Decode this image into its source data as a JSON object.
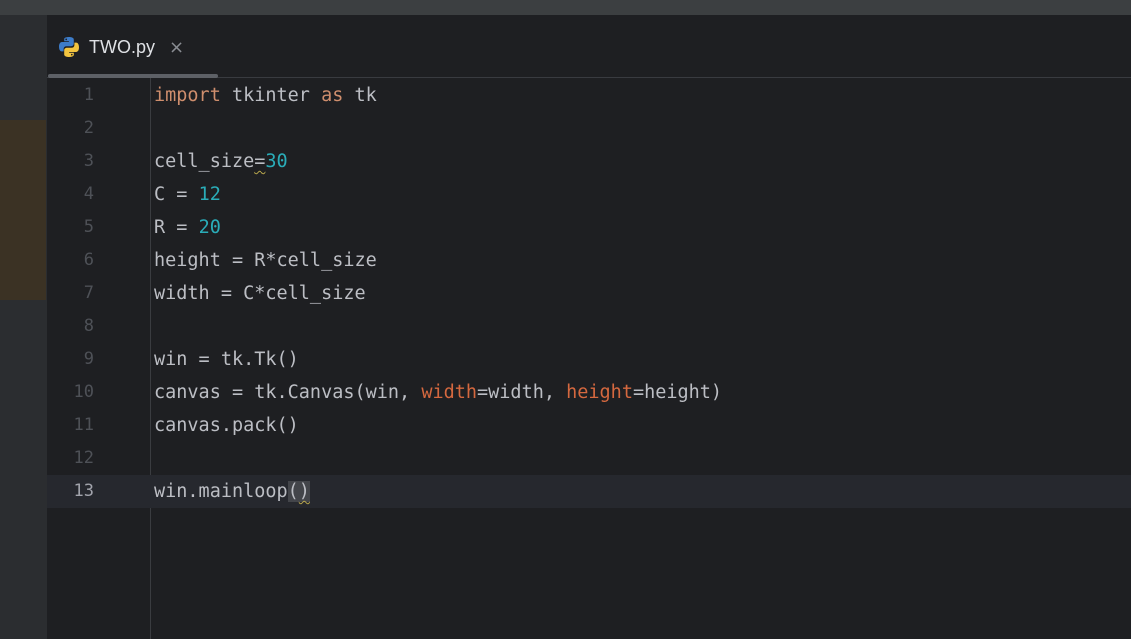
{
  "tab": {
    "filename": "TWO.py",
    "close_glyph": "×",
    "icon": "python-icon"
  },
  "colors": {
    "keyword": "#cf8e6d",
    "number": "#2aacb8",
    "parameter": "#d5683f",
    "text": "#bcbec4",
    "background": "#1e1f22"
  },
  "editor": {
    "current_line": 13,
    "lines": [
      {
        "n": "1",
        "tokens": [
          {
            "t": "import",
            "c": "kw"
          },
          {
            "t": " tkinter ",
            "c": ""
          },
          {
            "t": "as",
            "c": "kw"
          },
          {
            "t": " tk",
            "c": ""
          }
        ]
      },
      {
        "n": "2",
        "tokens": []
      },
      {
        "n": "3",
        "tokens": [
          {
            "t": "cell_size",
            "c": ""
          },
          {
            "t": "=",
            "c": "squig"
          },
          {
            "t": "30",
            "c": "num"
          }
        ]
      },
      {
        "n": "4",
        "tokens": [
          {
            "t": "C = ",
            "c": ""
          },
          {
            "t": "12",
            "c": "num"
          }
        ]
      },
      {
        "n": "5",
        "tokens": [
          {
            "t": "R = ",
            "c": ""
          },
          {
            "t": "20",
            "c": "num"
          }
        ]
      },
      {
        "n": "6",
        "tokens": [
          {
            "t": "height = R*cell_size",
            "c": ""
          }
        ]
      },
      {
        "n": "7",
        "tokens": [
          {
            "t": "width = C*cell_size",
            "c": ""
          }
        ]
      },
      {
        "n": "8",
        "tokens": []
      },
      {
        "n": "9",
        "tokens": [
          {
            "t": "win = tk.Tk()",
            "c": ""
          }
        ]
      },
      {
        "n": "10",
        "tokens": [
          {
            "t": "canvas = tk.Canvas(win, ",
            "c": ""
          },
          {
            "t": "width",
            "c": "param"
          },
          {
            "t": "=width, ",
            "c": ""
          },
          {
            "t": "height",
            "c": "param"
          },
          {
            "t": "=height)",
            "c": ""
          }
        ]
      },
      {
        "n": "11",
        "tokens": [
          {
            "t": "canvas.pack()",
            "c": ""
          }
        ]
      },
      {
        "n": "12",
        "tokens": []
      },
      {
        "n": "13",
        "tokens": [
          {
            "t": "win.mainloop",
            "c": ""
          },
          {
            "t": "(",
            "c": "paren-match"
          },
          {
            "t": ")",
            "c": "paren-match squig"
          }
        ]
      }
    ]
  }
}
